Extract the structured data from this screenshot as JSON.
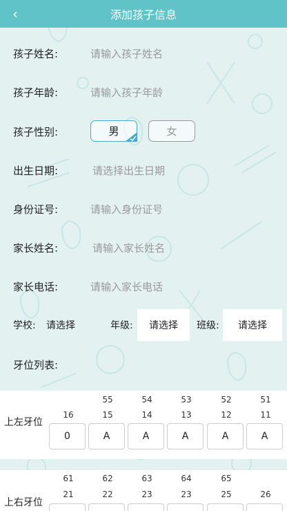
{
  "header": {
    "title": "添加孩子信息",
    "back_icon": "chevron-left-icon"
  },
  "form": {
    "child_name": {
      "label": "孩子姓名:",
      "placeholder": "请输入孩子姓名"
    },
    "child_age": {
      "label": "孩子年龄:",
      "placeholder": "请输入孩子年龄"
    },
    "child_gender": {
      "label": "孩子性别:",
      "options": [
        "男",
        "女"
      ],
      "selected": "男"
    },
    "birth_date": {
      "label": "出生日期:",
      "placeholder": "请选择出生日期"
    },
    "id_number": {
      "label": "身份证号:",
      "placeholder": "请输入身份证号"
    },
    "parent_name": {
      "label": "家长姓名:",
      "placeholder": "请输入家长姓名"
    },
    "parent_phone": {
      "label": "家长电话:",
      "placeholder": "请输入家长电话"
    },
    "school": {
      "label": "学校:",
      "value": "请选择"
    },
    "grade": {
      "label": "年级:",
      "value": "请选择"
    },
    "class": {
      "label": "班级:",
      "value": "请选择"
    },
    "teeth_list_label": "牙位列表:"
  },
  "teeth": {
    "upper_left": {
      "label": "上左牙位",
      "primary": [
        "",
        "55",
        "54",
        "53",
        "52",
        "51"
      ],
      "permanent": [
        "16",
        "15",
        "14",
        "13",
        "12",
        "11"
      ],
      "values": [
        "0",
        "A",
        "A",
        "A",
        "A",
        "A"
      ]
    },
    "upper_right": {
      "label": "上右牙位",
      "primary": [
        "61",
        "62",
        "63",
        "64",
        "65",
        ""
      ],
      "permanent": [
        "21",
        "22",
        "23",
        "23",
        "25",
        "26"
      ]
    }
  },
  "colors": {
    "header": "#5fc3c7",
    "background": "#e4f1f1",
    "accent": "#4aa8cc"
  }
}
